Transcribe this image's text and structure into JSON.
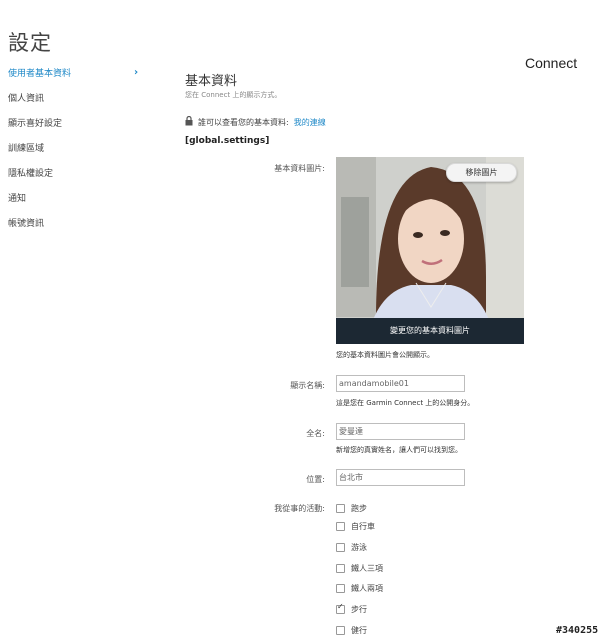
{
  "page_title": "設定",
  "brand": "Connect",
  "sidebar": {
    "items": [
      {
        "label": "使用者基本資料",
        "active": true
      },
      {
        "label": "個人資訊"
      },
      {
        "label": "顯示喜好設定"
      },
      {
        "label": "訓練區域"
      },
      {
        "label": "隱私權設定"
      },
      {
        "label": "通知"
      },
      {
        "label": "帳號資訊"
      }
    ],
    "active_chevron": "›"
  },
  "section": {
    "title": "基本資料",
    "subtitle": "您在 Connect 上的顯示方式。",
    "visibility_text": "誰可以查看您的基本資料:",
    "visibility_link": "我的連線",
    "global_settings": "[global.settings]"
  },
  "profile_photo": {
    "label": "基本資料圖片:",
    "remove_button": "移除圖片",
    "change_button": "變更您的基本資料圖片",
    "helper": "您的基本資料圖片會公開顯示。"
  },
  "display_name": {
    "label": "顯示名稱:",
    "value": "amandamobile01",
    "helper": "這是您在 Garmin Connect 上的公開身分。"
  },
  "full_name": {
    "label": "全名:",
    "value": "愛曼達",
    "helper": "新增您的真實姓名，讓人們可以找到您。"
  },
  "location": {
    "label": "位置:",
    "value": "台北市"
  },
  "activities": {
    "label": "我從事的活動:",
    "items": [
      {
        "label": "跑步",
        "checked": false
      },
      {
        "label": "自行車",
        "checked": false
      },
      {
        "label": "游泳",
        "checked": false
      },
      {
        "label": "鐵人三項",
        "checked": false
      },
      {
        "label": "鐵人兩項",
        "checked": false
      },
      {
        "label": "步行",
        "checked": true
      },
      {
        "label": "健行",
        "checked": false
      }
    ]
  },
  "watermark": "#340255",
  "colors": {
    "link": "#1e88c7",
    "photo_bar": "#1c2833"
  }
}
